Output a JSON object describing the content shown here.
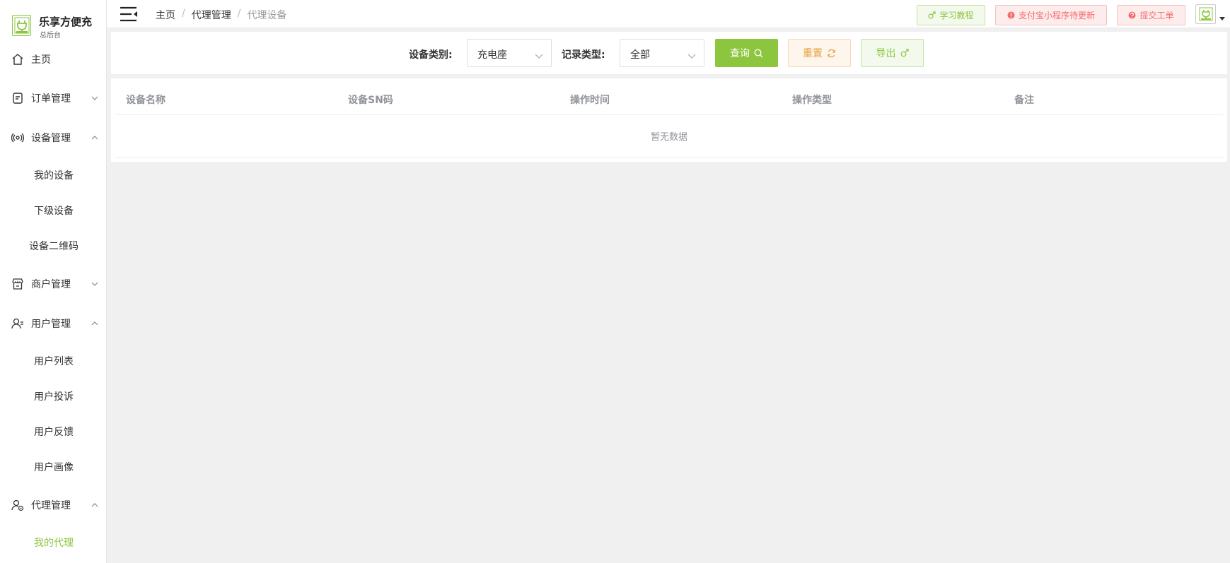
{
  "brand": {
    "title": "乐享方便充",
    "subtitle": "总后台",
    "accent": "#8cc63f"
  },
  "sidebar": {
    "items": [
      {
        "label": "主页",
        "icon": "home-icon"
      },
      {
        "label": "订单管理",
        "icon": "order-icon",
        "expanded": false
      },
      {
        "label": "设备管理",
        "icon": "device-icon",
        "expanded": true,
        "children": [
          "我的设备",
          "下级设备",
          "设备二维码"
        ]
      },
      {
        "label": "商户管理",
        "icon": "shop-icon",
        "expanded": false
      },
      {
        "label": "用户管理",
        "icon": "user-icon",
        "expanded": true,
        "children": [
          "用户列表",
          "用户投诉",
          "用户反馈",
          "用户画像"
        ]
      },
      {
        "label": "代理管理",
        "icon": "agent-icon",
        "expanded": true,
        "children": [
          "我的代理"
        ]
      }
    ],
    "active_sub": "我的代理"
  },
  "header": {
    "breadcrumb": [
      "主页",
      "代理管理",
      "代理设备"
    ],
    "breadcrumb_sep": "/",
    "buttons": {
      "tutorial": "学习教程",
      "alipay": "支付宝小程序待更新",
      "ticket": "提交工单"
    }
  },
  "filters": {
    "device_type_label": "设备类别:",
    "device_type_value": "充电座",
    "record_type_label": "记录类型:",
    "record_type_value": "全部",
    "query_label": "查询",
    "reset_label": "重置",
    "export_label": "导出"
  },
  "table": {
    "columns": [
      "设备名称",
      "设备SN码",
      "操作时间",
      "操作类型",
      "备注"
    ],
    "rows": [],
    "empty_text": "暂无数据"
  },
  "colors": {
    "primary": "#8cc63f",
    "warning": "#e6a23c",
    "danger": "#f56c6c",
    "background": "#f0f0f0"
  }
}
